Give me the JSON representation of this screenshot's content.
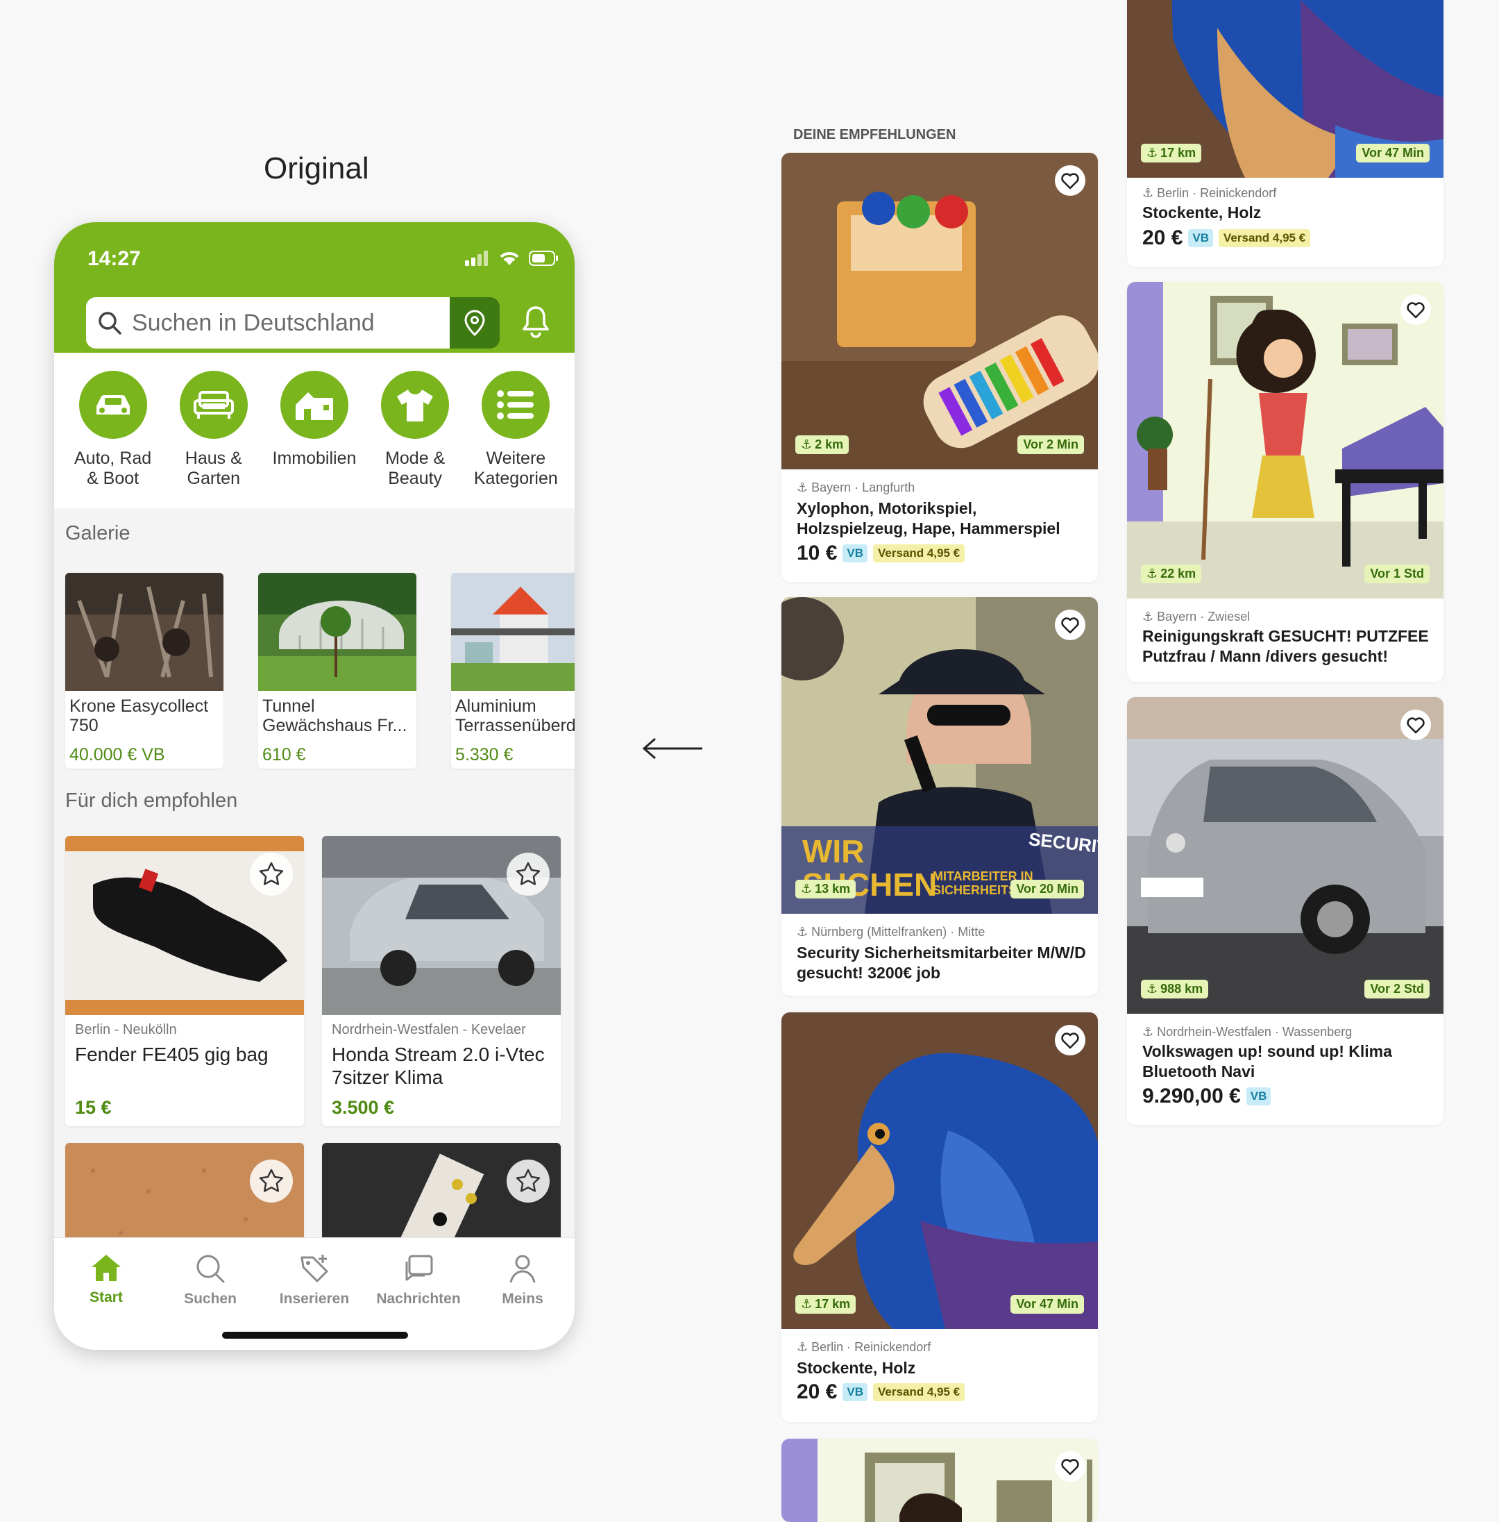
{
  "caption": "Original",
  "phone": {
    "time": "14:27",
    "search_placeholder": "Suchen in Deutschland",
    "categories": [
      {
        "label": "Auto, Rad\n& Boot",
        "icon": "car-icon"
      },
      {
        "label": "Haus &\nGarten",
        "icon": "sofa-icon"
      },
      {
        "label": "Immobilien",
        "icon": "house-icon"
      },
      {
        "label": "Mode &\nBeauty",
        "icon": "shirt-icon"
      },
      {
        "label": "Weitere\nKategorien",
        "icon": "list-icon"
      }
    ],
    "gallery_title": "Galerie",
    "gallery": [
      {
        "title": "Krone Easycollect\n750",
        "price": "40.000 € VB"
      },
      {
        "title": "Tunnel\nGewächshaus Fr...",
        "price": "610 €"
      },
      {
        "title": "Aluminium\nTerrassenüberd",
        "price": "5.330 €"
      }
    ],
    "recommended_title": "Für dich empfohlen",
    "recommended": [
      {
        "location": "Berlin - Neukölln",
        "title": "Fender FE405 gig bag",
        "price": "15 €"
      },
      {
        "location": "Nordrhein-Westfalen - Kevelaer",
        "title": "Honda Stream 2.0 i-Vtec 7sitzer Klima",
        "price": "3.500 €"
      }
    ],
    "tabs": [
      {
        "label": "Start",
        "icon": "home-icon",
        "active": true
      },
      {
        "label": "Suchen",
        "icon": "search-icon",
        "active": false
      },
      {
        "label": "Inserieren",
        "icon": "tag-add-icon",
        "active": false
      },
      {
        "label": "Nachrichten",
        "icon": "chat-icon",
        "active": false
      },
      {
        "label": "Meins",
        "icon": "user-icon",
        "active": false
      }
    ]
  },
  "redesign": {
    "section_title": "DEINE EMPFEHLUNGEN",
    "cards": [
      {
        "distance": "2 km",
        "ago": "Vor 2 Min",
        "location": "Bayern · Langfurth",
        "title": "Xylophon, Motorikspiel, Holzspielzeug, Hape, Hammerspiel",
        "price": "10 €",
        "vb": "VB",
        "shipping": "Versand 4,95 €"
      },
      {
        "distance": "13 km",
        "ago": "Vor 20 Min",
        "location": "Nürnberg (Mittelfranken) · Mitte",
        "title": "Security Sicherheitsmitarbeiter M/W/D gesucht! 3200€ job",
        "overlay_1": "WIR SUCHEN",
        "overlay_2": "SECURITY",
        "overlay_3": "MITARBEITER IN SICHERHEITS"
      },
      {
        "distance": "17 km",
        "ago": "Vor 47 Min",
        "location": "Berlin · Reinickendorf",
        "title": "Stockente, Holz",
        "price": "20 €",
        "vb": "VB",
        "shipping": "Versand 4,95 €"
      },
      {
        "distance": "17 km",
        "ago": "Vor 47 Min",
        "location": "Berlin · Reinickendorf",
        "title": "Stockente, Holz",
        "price": "20 €",
        "vb": "VB",
        "shipping": "Versand 4,95 €"
      },
      {
        "distance": "22 km",
        "ago": "Vor 1 Std",
        "location": "Bayern · Zwiesel",
        "title": "Reinigungskraft GESUCHT! PUTZFEE Putzfrau / Mann /divers gesucht!"
      },
      {
        "distance": "988 km",
        "ago": "Vor 2 Std",
        "location": "Nordrhein-Westfalen · Wassenberg",
        "title": "Volkswagen up! sound up! Klima Bluetooth Navi",
        "price": "9.290,00 €",
        "vb": "VB"
      }
    ]
  },
  "colors": {
    "brand_green": "#7ab51d",
    "dark_green": "#3d7a12",
    "price_green": "#4f8b13"
  }
}
